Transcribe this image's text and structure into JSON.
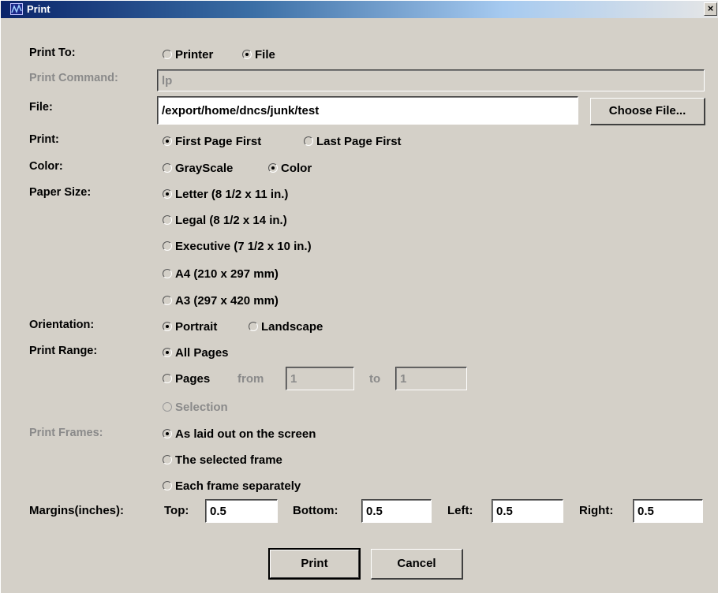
{
  "window": {
    "title": "Print",
    "close_glyph": "×"
  },
  "labels": {
    "print_to": "Print To:",
    "print_command": "Print Command:",
    "file": "File:",
    "print": "Print:",
    "color": "Color:",
    "paper_size": "Paper Size:",
    "orientation": "Orientation:",
    "print_range": "Print Range:",
    "print_frames": "Print Frames:",
    "margins": "Margins(inches):"
  },
  "print_to": {
    "printer": "Printer",
    "file": "File",
    "selected": "file"
  },
  "print_command": {
    "value": "lp"
  },
  "file": {
    "value": "/export/home/dncs/junk/test",
    "choose_label": "Choose File..."
  },
  "print_order": {
    "first": "First Page First",
    "last": "Last Page First",
    "selected": "first"
  },
  "color": {
    "gray": "GrayScale",
    "color": "Color",
    "selected": "color"
  },
  "paper_sizes": [
    "Letter (8 1/2 x 11 in.)",
    "Legal (8 1/2 x 14 in.)",
    "Executive (7 1/2 x 10 in.)",
    "A4 (210 x 297 mm)",
    "A3 (297 x 420 mm)"
  ],
  "paper_selected": "Letter (8 1/2 x 11 in.)",
  "orientation": {
    "portrait": "Portrait",
    "landscape": "Landscape",
    "selected": "portrait"
  },
  "print_range": {
    "all": "All Pages",
    "pages": "Pages",
    "from_label": "from",
    "from_value": "1",
    "to_label": "to",
    "to_value": "1",
    "selection": "Selection",
    "selected": "all"
  },
  "print_frames": {
    "as_laid_out": "As laid out on the screen",
    "selected_frame": "The selected frame",
    "each_separately": "Each frame separately",
    "selected": "as_laid_out"
  },
  "margins": {
    "top_label": "Top:",
    "top_value": "0.5",
    "bottom_label": "Bottom:",
    "bottom_value": "0.5",
    "left_label": "Left:",
    "left_value": "0.5",
    "right_label": "Right:",
    "right_value": "0.5"
  },
  "buttons": {
    "print": "Print",
    "cancel": "Cancel"
  },
  "colors": {
    "titlebar_start": "#0a246a",
    "window_bg": "#d4d0c8",
    "disabled_text": "#8a8a8a"
  }
}
